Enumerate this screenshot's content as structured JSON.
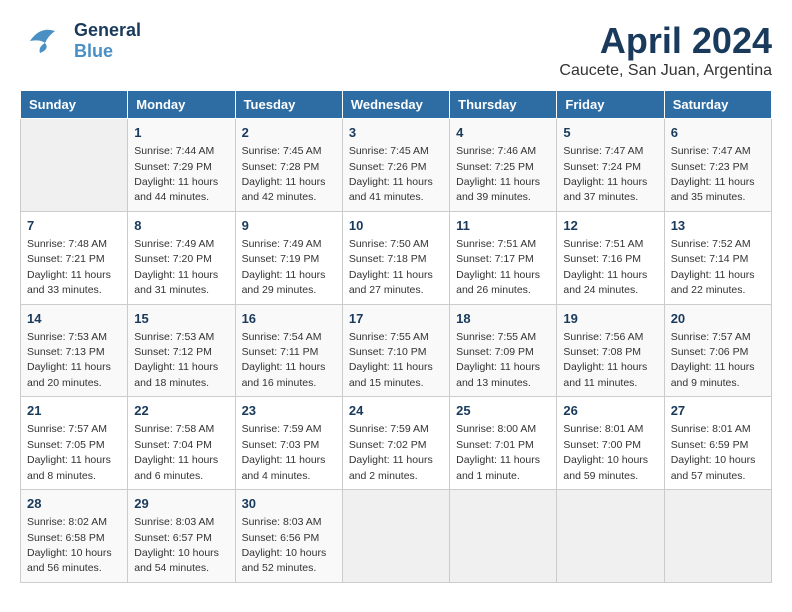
{
  "header": {
    "logo_general": "General",
    "logo_blue": "Blue",
    "month_title": "April 2024",
    "location": "Caucete, San Juan, Argentina"
  },
  "days_of_week": [
    "Sunday",
    "Monday",
    "Tuesday",
    "Wednesday",
    "Thursday",
    "Friday",
    "Saturday"
  ],
  "weeks": [
    [
      {
        "day": "",
        "info": ""
      },
      {
        "day": "1",
        "info": "Sunrise: 7:44 AM\nSunset: 7:29 PM\nDaylight: 11 hours\nand 44 minutes."
      },
      {
        "day": "2",
        "info": "Sunrise: 7:45 AM\nSunset: 7:28 PM\nDaylight: 11 hours\nand 42 minutes."
      },
      {
        "day": "3",
        "info": "Sunrise: 7:45 AM\nSunset: 7:26 PM\nDaylight: 11 hours\nand 41 minutes."
      },
      {
        "day": "4",
        "info": "Sunrise: 7:46 AM\nSunset: 7:25 PM\nDaylight: 11 hours\nand 39 minutes."
      },
      {
        "day": "5",
        "info": "Sunrise: 7:47 AM\nSunset: 7:24 PM\nDaylight: 11 hours\nand 37 minutes."
      },
      {
        "day": "6",
        "info": "Sunrise: 7:47 AM\nSunset: 7:23 PM\nDaylight: 11 hours\nand 35 minutes."
      }
    ],
    [
      {
        "day": "7",
        "info": "Sunrise: 7:48 AM\nSunset: 7:21 PM\nDaylight: 11 hours\nand 33 minutes."
      },
      {
        "day": "8",
        "info": "Sunrise: 7:49 AM\nSunset: 7:20 PM\nDaylight: 11 hours\nand 31 minutes."
      },
      {
        "day": "9",
        "info": "Sunrise: 7:49 AM\nSunset: 7:19 PM\nDaylight: 11 hours\nand 29 minutes."
      },
      {
        "day": "10",
        "info": "Sunrise: 7:50 AM\nSunset: 7:18 PM\nDaylight: 11 hours\nand 27 minutes."
      },
      {
        "day": "11",
        "info": "Sunrise: 7:51 AM\nSunset: 7:17 PM\nDaylight: 11 hours\nand 26 minutes."
      },
      {
        "day": "12",
        "info": "Sunrise: 7:51 AM\nSunset: 7:16 PM\nDaylight: 11 hours\nand 24 minutes."
      },
      {
        "day": "13",
        "info": "Sunrise: 7:52 AM\nSunset: 7:14 PM\nDaylight: 11 hours\nand 22 minutes."
      }
    ],
    [
      {
        "day": "14",
        "info": "Sunrise: 7:53 AM\nSunset: 7:13 PM\nDaylight: 11 hours\nand 20 minutes."
      },
      {
        "day": "15",
        "info": "Sunrise: 7:53 AM\nSunset: 7:12 PM\nDaylight: 11 hours\nand 18 minutes."
      },
      {
        "day": "16",
        "info": "Sunrise: 7:54 AM\nSunset: 7:11 PM\nDaylight: 11 hours\nand 16 minutes."
      },
      {
        "day": "17",
        "info": "Sunrise: 7:55 AM\nSunset: 7:10 PM\nDaylight: 11 hours\nand 15 minutes."
      },
      {
        "day": "18",
        "info": "Sunrise: 7:55 AM\nSunset: 7:09 PM\nDaylight: 11 hours\nand 13 minutes."
      },
      {
        "day": "19",
        "info": "Sunrise: 7:56 AM\nSunset: 7:08 PM\nDaylight: 11 hours\nand 11 minutes."
      },
      {
        "day": "20",
        "info": "Sunrise: 7:57 AM\nSunset: 7:06 PM\nDaylight: 11 hours\nand 9 minutes."
      }
    ],
    [
      {
        "day": "21",
        "info": "Sunrise: 7:57 AM\nSunset: 7:05 PM\nDaylight: 11 hours\nand 8 minutes."
      },
      {
        "day": "22",
        "info": "Sunrise: 7:58 AM\nSunset: 7:04 PM\nDaylight: 11 hours\nand 6 minutes."
      },
      {
        "day": "23",
        "info": "Sunrise: 7:59 AM\nSunset: 7:03 PM\nDaylight: 11 hours\nand 4 minutes."
      },
      {
        "day": "24",
        "info": "Sunrise: 7:59 AM\nSunset: 7:02 PM\nDaylight: 11 hours\nand 2 minutes."
      },
      {
        "day": "25",
        "info": "Sunrise: 8:00 AM\nSunset: 7:01 PM\nDaylight: 11 hours\nand 1 minute."
      },
      {
        "day": "26",
        "info": "Sunrise: 8:01 AM\nSunset: 7:00 PM\nDaylight: 10 hours\nand 59 minutes."
      },
      {
        "day": "27",
        "info": "Sunrise: 8:01 AM\nSunset: 6:59 PM\nDaylight: 10 hours\nand 57 minutes."
      }
    ],
    [
      {
        "day": "28",
        "info": "Sunrise: 8:02 AM\nSunset: 6:58 PM\nDaylight: 10 hours\nand 56 minutes."
      },
      {
        "day": "29",
        "info": "Sunrise: 8:03 AM\nSunset: 6:57 PM\nDaylight: 10 hours\nand 54 minutes."
      },
      {
        "day": "30",
        "info": "Sunrise: 8:03 AM\nSunset: 6:56 PM\nDaylight: 10 hours\nand 52 minutes."
      },
      {
        "day": "",
        "info": ""
      },
      {
        "day": "",
        "info": ""
      },
      {
        "day": "",
        "info": ""
      },
      {
        "day": "",
        "info": ""
      }
    ]
  ]
}
